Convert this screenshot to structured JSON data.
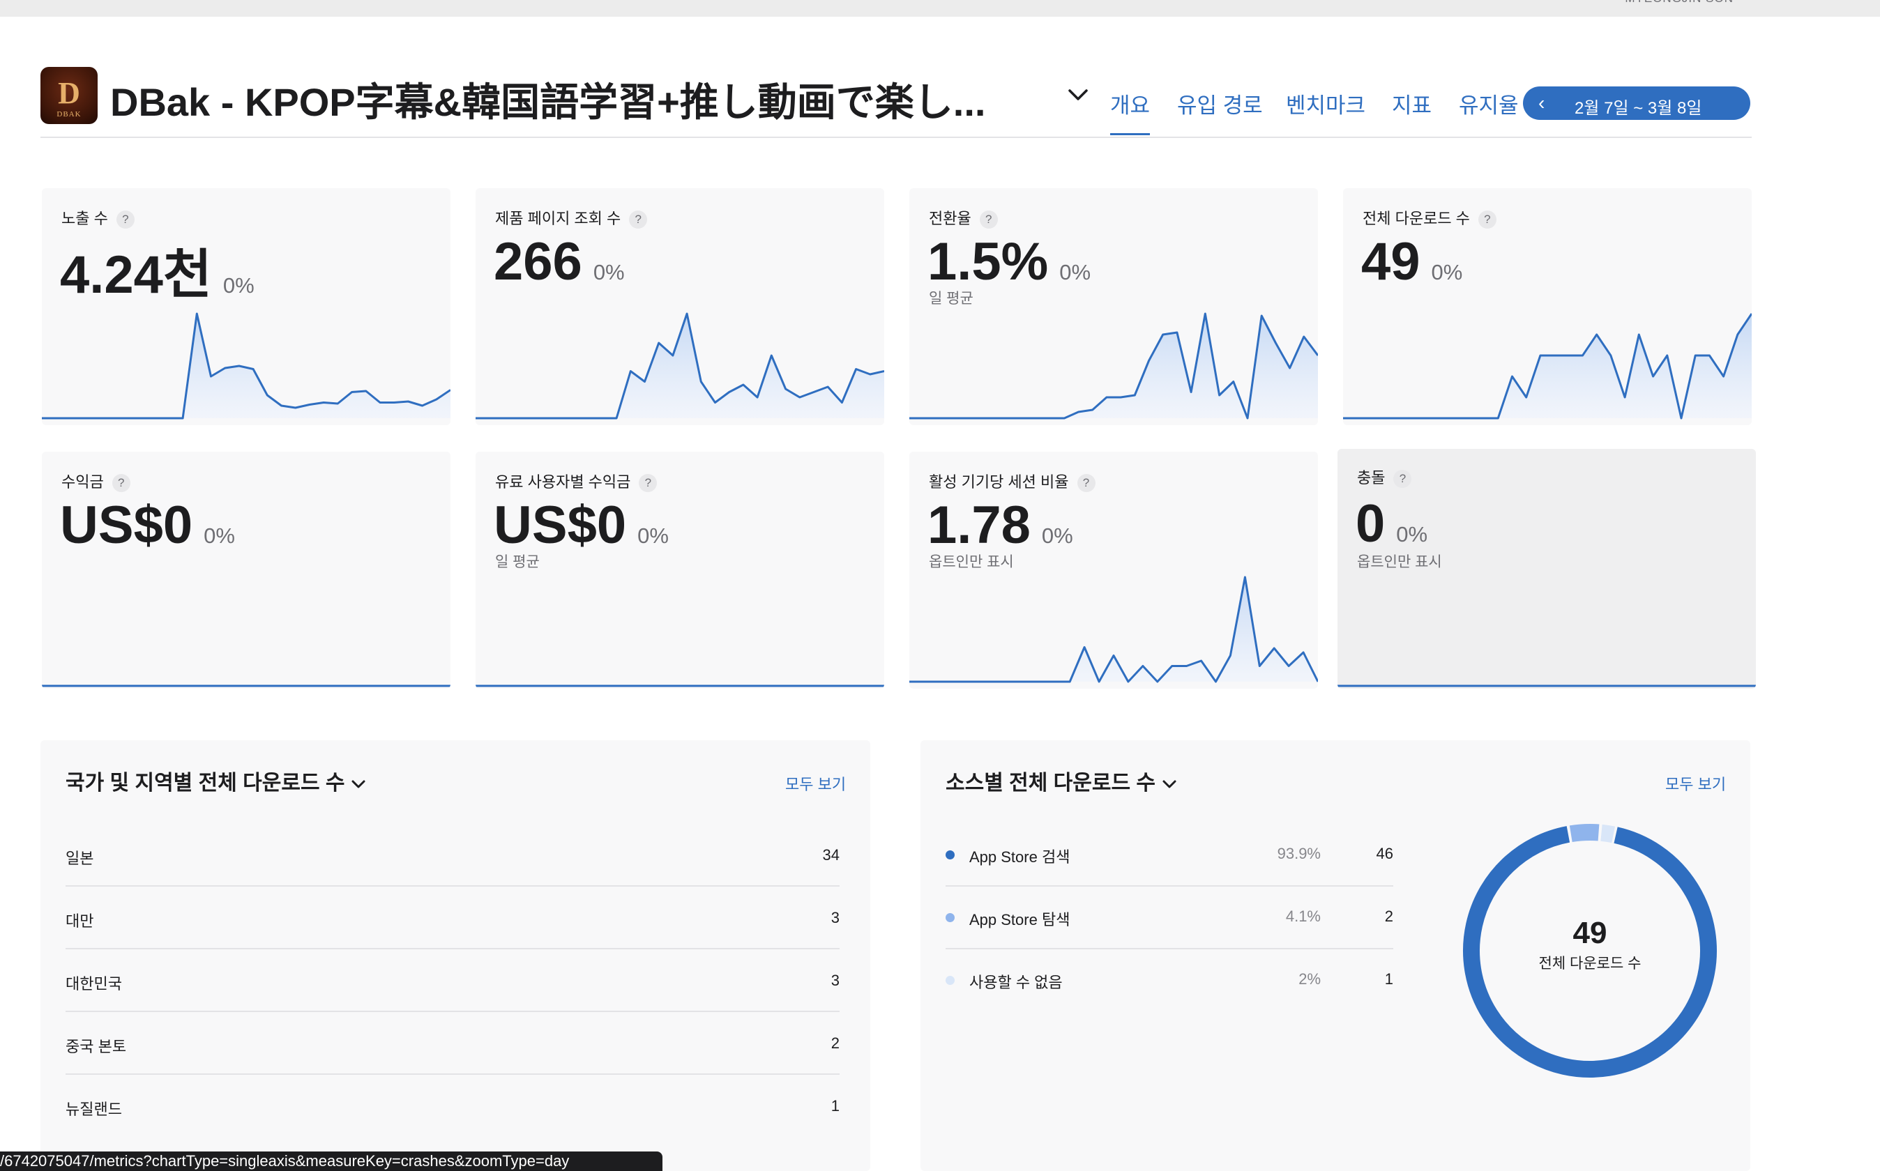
{
  "top": {
    "user_label": "MYEONGJIN SON"
  },
  "app": {
    "icon_letter": "D",
    "icon_caption": "DBAK",
    "title": "DBak - KPOP字幕&韓国語学習+推し動画で楽し..."
  },
  "tabs": [
    {
      "label": "개요",
      "active": true
    },
    {
      "label": "유입 경로",
      "active": false
    },
    {
      "label": "벤치마크",
      "active": false
    },
    {
      "label": "지표",
      "active": false
    },
    {
      "label": "유지율",
      "active": false
    }
  ],
  "date_range": {
    "prev_arrow": "‹",
    "label": "2월 7일 ~ 3월 8일"
  },
  "colors": {
    "accent": "#2f6ec0",
    "accent_light": "#8fb4ec",
    "accent_faint": "#d9e6f8",
    "card_bg": "#f8f8f9"
  },
  "metrics": [
    {
      "name": "노출 수",
      "help": "?",
      "value": "4.24천",
      "change": "0%",
      "sub": "",
      "series": [
        0,
        0,
        0,
        0,
        0,
        0,
        0,
        0,
        0,
        0,
        0,
        1,
        0.4,
        0.48,
        0.5,
        0.47,
        0.22,
        0.12,
        0.1,
        0.13,
        0.15,
        0.14,
        0.25,
        0.26,
        0.15,
        0.15,
        0.16,
        0.12,
        0.18,
        0.27
      ]
    },
    {
      "name": "제품 페이지 조회 수",
      "help": "?",
      "value": "266",
      "change": "0%",
      "sub": "",
      "series": [
        0,
        0,
        0,
        0,
        0,
        0,
        0,
        0,
        0,
        0,
        0,
        0.45,
        0.35,
        0.72,
        0.6,
        1,
        0.35,
        0.15,
        0.25,
        0.32,
        0.2,
        0.6,
        0.28,
        0.2,
        0.25,
        0.3,
        0.15,
        0.47,
        0.42,
        0.45
      ]
    },
    {
      "name": "전환율",
      "help": "?",
      "value": "1.5%",
      "change": "0%",
      "sub": "일 평균",
      "series": [
        0,
        0,
        0,
        0,
        0,
        0,
        0,
        0,
        0,
        0,
        0,
        0,
        0.06,
        0.08,
        0.2,
        0.2,
        0.22,
        0.55,
        0.8,
        0.82,
        0.25,
        1,
        0.22,
        0.35,
        0,
        0.98,
        0.72,
        0.48,
        0.78,
        0.6
      ]
    },
    {
      "name": "전체 다운로드 수",
      "help": "?",
      "value": "49",
      "change": "0%",
      "sub": "",
      "series": [
        0,
        0,
        0,
        0,
        0,
        0,
        0,
        0,
        0,
        0,
        0,
        0,
        0.4,
        0.2,
        0.6,
        0.6,
        0.6,
        0.6,
        0.8,
        0.6,
        0.2,
        0.8,
        0.4,
        0.6,
        0,
        0.6,
        0.6,
        0.4,
        0.8,
        1
      ]
    },
    {
      "name": "수익금",
      "help": "?",
      "value": "US$0",
      "change": "0%",
      "sub": "",
      "series": []
    },
    {
      "name": "유료 사용자별 수익금",
      "help": "?",
      "value": "US$0",
      "change": "0%",
      "sub": "일 평균",
      "series": []
    },
    {
      "name": "활성 기기당 세션 비율",
      "help": "?",
      "value": "1.78",
      "change": "0%",
      "sub": "옵트인만 표시",
      "series": [
        0,
        0,
        0,
        0,
        0,
        0,
        0,
        0,
        0,
        0,
        0,
        0,
        0.33,
        0,
        0.25,
        0,
        0.15,
        0,
        0.15,
        0.15,
        0.2,
        0,
        0.25,
        1,
        0.15,
        0.32,
        0.15,
        0.28,
        0
      ]
    },
    {
      "name": "충돌",
      "help": "?",
      "value": "0",
      "change": "0%",
      "sub": "옵트인만 표시",
      "series": []
    }
  ],
  "country_panel": {
    "title": "국가 및 지역별 전체 다운로드 수",
    "see_all": "모두 보기",
    "rows": [
      {
        "name": "일본",
        "value": "34"
      },
      {
        "name": "대만",
        "value": "3"
      },
      {
        "name": "대한민국",
        "value": "3"
      },
      {
        "name": "중국 본토",
        "value": "2"
      },
      {
        "name": "뉴질랜드",
        "value": "1"
      }
    ]
  },
  "source_panel": {
    "title": "소스별 전체 다운로드 수",
    "see_all": "모두 보기",
    "rows": [
      {
        "name": "App Store 검색",
        "pct": "93.9%",
        "value": "46",
        "share": 0.939,
        "color": "#2f6ec0"
      },
      {
        "name": "App Store 탐색",
        "pct": "4.1%",
        "value": "2",
        "share": 0.041,
        "color": "#8fb4ec"
      },
      {
        "name": "사용할 수 없음",
        "pct": "2%",
        "value": "1",
        "share": 0.02,
        "color": "#d9e6f8"
      }
    ],
    "donut_value": "49",
    "donut_label": "전체 다운로드 수"
  },
  "status_url": "/6742075047/metrics?chartType=singleaxis&measureKey=crashes&zoomType=day"
}
